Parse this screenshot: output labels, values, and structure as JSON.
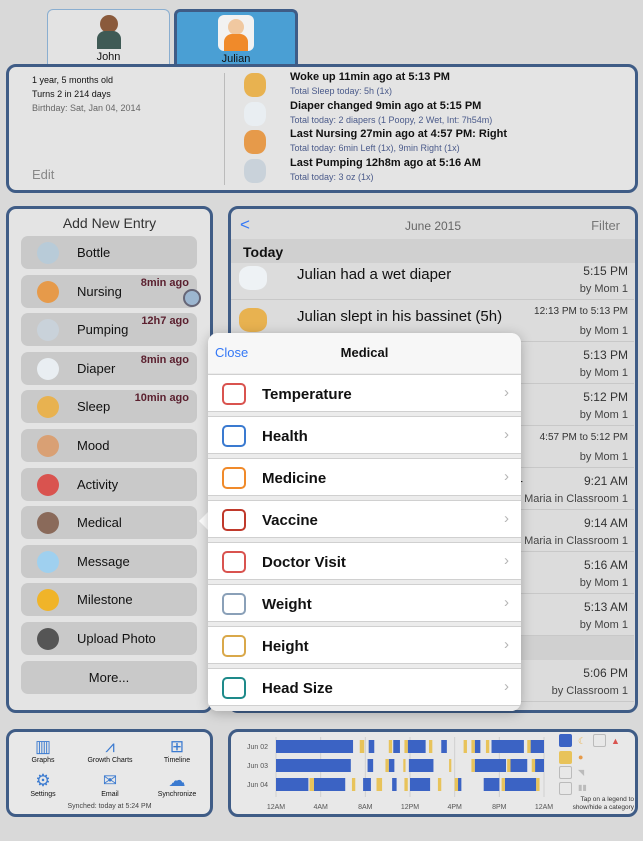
{
  "tabs": [
    {
      "name": "John",
      "active": false
    },
    {
      "name": "Julian",
      "active": true
    }
  ],
  "profile": {
    "age": "1 year, 5 months old",
    "turns": "Turns 2 in 214 days",
    "birthday": "Birthday: Sat, Jan 04, 2014",
    "edit": "Edit"
  },
  "summary": [
    {
      "icon": "sleep-moon-icon",
      "title": "Woke up  11min ago at 5:13 PM",
      "detail": "Total Sleep today:  5h (1x)"
    },
    {
      "icon": "diaper-icon",
      "title": "Diaper changed  9min ago at 5:15 PM",
      "detail": "Total today:  2 diapers (1 Poopy, 2 Wet, Int: 7h54m)"
    },
    {
      "icon": "nursing-icon",
      "title": "Last Nursing  27min ago at 4:57 PM: Right",
      "detail": "Total today:  6min Left (1x), 9min Right (1x)"
    },
    {
      "icon": "pumping-icon",
      "title": "Last Pumping  12h8m ago at 5:16 AM",
      "detail": "Total today:  3 oz (1x)"
    }
  ],
  "add_entry": {
    "title": "Add New Entry",
    "items": [
      {
        "label": "Bottle",
        "ago": "",
        "icon": "bottle-icon",
        "color": "#b8cbd8"
      },
      {
        "label": "Nursing",
        "ago": "8min ago",
        "icon": "nursing-icon",
        "color": "#e69a4a"
      },
      {
        "label": "Pumping",
        "ago": "12h7 ago",
        "icon": "pumping-icon",
        "color": "#c9d2da"
      },
      {
        "label": "Diaper",
        "ago": "8min ago",
        "icon": "diaper-icon",
        "color": "#e9eef2"
      },
      {
        "label": "Sleep",
        "ago": "10min ago",
        "icon": "sleep-moon-icon",
        "color": "#e8b250"
      },
      {
        "label": "Mood",
        "ago": "",
        "icon": "mood-face-icon",
        "color": "#d9a074"
      },
      {
        "label": "Activity",
        "ago": "",
        "icon": "activity-blocks-icon",
        "color": "#d9534f"
      },
      {
        "label": "Medical",
        "ago": "",
        "icon": "medical-doctor-icon",
        "color": "#8a6a5a"
      },
      {
        "label": "Message",
        "ago": "",
        "icon": "message-bubble-icon",
        "color": "#9fd0ef"
      },
      {
        "label": "Milestone",
        "ago": "",
        "icon": "star-icon",
        "color": "#f0b429"
      },
      {
        "label": "Upload Photo",
        "ago": "",
        "icon": "camera-icon",
        "color": "#555555"
      },
      {
        "label": "More...",
        "ago": "",
        "icon": "",
        "color": ""
      }
    ]
  },
  "log": {
    "back": "<",
    "month": "June 2015",
    "filter": "Filter",
    "section": "Today",
    "rows": [
      {
        "title": "Julian had a wet diaper",
        "time": "5:15 PM",
        "by": "by Mom 1",
        "icon": "diaper-icon"
      },
      {
        "title": "Julian slept in his bassinet (5h)",
        "time": "12:13 PM to 5:13 PM",
        "by": "by Mom 1",
        "icon": "sleep-moon-icon"
      },
      {
        "title": "",
        "time": "5:13 PM",
        "by": "by Mom 1"
      },
      {
        "title": "",
        "time": "5:12 PM",
        "by": "by Mom 1"
      },
      {
        "title": "t)",
        "time": "4:57 PM to 5:12 PM",
        "by": "by Mom 1"
      },
      {
        "title": "er",
        "time": "9:21 AM",
        "by": "y Maria in Classroom 1"
      },
      {
        "title": "",
        "time": "9:14 AM",
        "by": "y Maria in Classroom 1"
      },
      {
        "title": "",
        "time": "5:16 AM",
        "by": "by Mom 1"
      },
      {
        "title": "",
        "time": "5:13 AM",
        "by": "by Mom 1"
      },
      {
        "title": "",
        "time": "5:06 PM",
        "by": "by Classroom 1"
      }
    ]
  },
  "medical_popover": {
    "close": "Close",
    "title": "Medical",
    "items": [
      {
        "label": "Temperature",
        "icon": "thermometer-icon"
      },
      {
        "label": "Health",
        "icon": "stethoscope-icon"
      },
      {
        "label": "Medicine",
        "icon": "medicine-bottle-icon"
      },
      {
        "label": "Vaccine",
        "icon": "syringe-icon"
      },
      {
        "label": "Doctor Visit",
        "icon": "calendar-doctor-icon"
      },
      {
        "label": "Weight",
        "icon": "scale-icon"
      },
      {
        "label": "Height",
        "icon": "ruler-icon"
      },
      {
        "label": "Head Size",
        "icon": "tape-measure-icon"
      }
    ]
  },
  "tools": [
    {
      "label": "Graphs",
      "icon": "bar-graph-icon",
      "glyph": "▥"
    },
    {
      "label": "Growth Charts",
      "icon": "growth-chart-icon",
      "glyph": "⩘"
    },
    {
      "label": "Timeline",
      "icon": "timeline-icon",
      "glyph": "⊞"
    },
    {
      "label": "Settings",
      "icon": "gear-icon",
      "glyph": "⚙"
    },
    {
      "label": "Email",
      "icon": "envelope-icon",
      "glyph": "✉"
    },
    {
      "label": "Synchronize",
      "icon": "cloud-sync-icon",
      "glyph": "☁"
    }
  ],
  "sync_status": "Synched: today at 5:24 PM",
  "legend_hint": "Tap on a legend to show/hide a category",
  "colors": {
    "accent": "#3478f6",
    "tab_active": "#4a9fd4",
    "border": "#3f5c86",
    "sleep": "#3b63c4",
    "nursing": "#e8c35a"
  },
  "chart_data": {
    "type": "timeline",
    "xlabel": "",
    "ylabel": "",
    "x_ticks": [
      "12AM",
      "4AM",
      "8AM",
      "12PM",
      "4PM",
      "8PM",
      "12AM"
    ],
    "xlim": [
      0,
      24
    ],
    "categories": [
      "Jun 02",
      "Jun 03",
      "Jun 04"
    ],
    "series": [
      {
        "name": "sleep",
        "color": "#3b63c4",
        "rows": [
          [
            [
              0,
              6.9
            ],
            [
              8.3,
              8.8
            ],
            [
              10.5,
              11.1
            ],
            [
              11.8,
              13.4
            ],
            [
              14.8,
              15.3
            ],
            [
              17.8,
              18.3
            ],
            [
              19.3,
              22.2
            ],
            [
              22.8,
              24
            ]
          ],
          [
            [
              0,
              6.7
            ],
            [
              8.2,
              8.7
            ],
            [
              10.1,
              10.6
            ],
            [
              11.9,
              14.1
            ],
            [
              17.8,
              20.6
            ],
            [
              21,
              22.5
            ],
            [
              23.2,
              24
            ]
          ],
          [
            [
              0,
              2.9
            ],
            [
              3.4,
              6.2
            ],
            [
              7.8,
              8.5
            ],
            [
              10.4,
              10.8
            ],
            [
              12,
              13.8
            ],
            [
              16.3,
              16.6
            ],
            [
              18.6,
              20
            ],
            [
              20.5,
              23.3
            ]
          ]
        ]
      },
      {
        "name": "nursing",
        "color": "#e8c35a",
        "rows": [
          [
            [
              7.5,
              7.9
            ],
            [
              10.1,
              10.4
            ],
            [
              11.5,
              11.8
            ],
            [
              13.7,
              14
            ],
            [
              16.8,
              17.1
            ],
            [
              17.5,
              17.8
            ],
            [
              18.8,
              19.1
            ],
            [
              22.5,
              22.8
            ]
          ],
          [
            [
              9.8,
              10.1
            ],
            [
              11.4,
              11.6
            ],
            [
              15.5,
              15.7
            ],
            [
              17.5,
              17.8
            ],
            [
              20.7,
              21
            ],
            [
              22.9,
              23.2
            ]
          ],
          [
            [
              3,
              3.4
            ],
            [
              6.8,
              7.1
            ],
            [
              9,
              9.5
            ],
            [
              11.5,
              11.8
            ],
            [
              14.5,
              14.8
            ],
            [
              16,
              16.3
            ],
            [
              20.2,
              20.5
            ],
            [
              23.3,
              23.6
            ]
          ]
        ]
      }
    ]
  }
}
